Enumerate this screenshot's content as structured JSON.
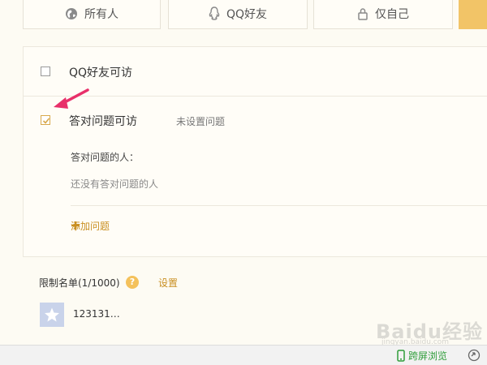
{
  "tabs": [
    {
      "label": "所有人",
      "icon": "globe-icon"
    },
    {
      "label": "QQ好友",
      "icon": "qq-penguin-icon"
    },
    {
      "label": "仅自己",
      "icon": "lock-icon"
    }
  ],
  "options": {
    "qq_friends": {
      "label": "QQ好友可访",
      "checked": false
    },
    "answer_question": {
      "label": "答对问题可访",
      "checked": true,
      "status": "未设置问题"
    }
  },
  "answered": {
    "title": "答对问题的人：",
    "empty": "还没有答对问题的人"
  },
  "add_question": {
    "label": "添加问题"
  },
  "limit_list": {
    "title": "限制名单(1/1000)",
    "help": "?",
    "settings": "设置"
  },
  "limit_user": {
    "name": "123131…"
  },
  "watermark": {
    "text": "Baidu经验",
    "sub": "jingyan.baidu.com"
  },
  "status_bar": {
    "dual_screen": "跨屏浏览"
  },
  "colors": {
    "accent": "#c98f22",
    "tab_highlight": "#f2c467",
    "arrow": "#e8306a",
    "status_green": "#2f9d3a"
  }
}
